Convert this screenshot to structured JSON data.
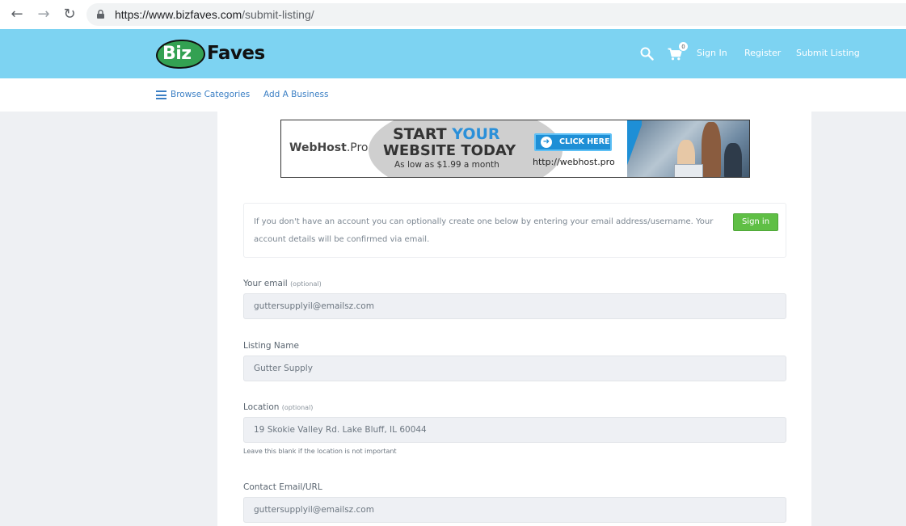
{
  "browser": {
    "url_host": "https://www.bizfaves.com",
    "url_path": "/submit-listing/"
  },
  "header": {
    "logo_biz": "Biz",
    "logo_faves": "Faves",
    "cart_count": "0",
    "nav": [
      "Sign In",
      "Register",
      "Submit Listing"
    ]
  },
  "subnav": {
    "browse": "Browse Categories",
    "add": "Add A Business"
  },
  "ad": {
    "logo_main": "WebHost",
    "logo_suffix": ".Pro",
    "line1_a": "START ",
    "line1_b": "YOUR",
    "line2": "WEBSITE TODAY",
    "price": "As low as $1.99 a month",
    "cta": "CLICK HERE",
    "url": "http://webhost.pro"
  },
  "info": {
    "text": "If you don't have an account you can optionally create one below by entering your email address/username. Your account details will be confirmed via email.",
    "signin_button": "Sign in"
  },
  "form": {
    "email": {
      "label": "Your email",
      "optional": "(optional)",
      "value": "guttersupplyil@emailsz.com"
    },
    "listing_name": {
      "label": "Listing Name",
      "value": "Gutter Supply"
    },
    "location": {
      "label": "Location",
      "optional": "(optional)",
      "value": "19 Skokie Valley Rd. Lake Bluff, IL 60044",
      "hint": "Leave this blank if the location is not important"
    },
    "contact": {
      "label": "Contact Email/URL",
      "value": "guttersupplyil@emailsz.com"
    }
  },
  "colors": {
    "header_bg": "#7dd3f2",
    "link": "#3b7fc4",
    "signin_green": "#5fbf45",
    "logo_green": "#33a152"
  }
}
